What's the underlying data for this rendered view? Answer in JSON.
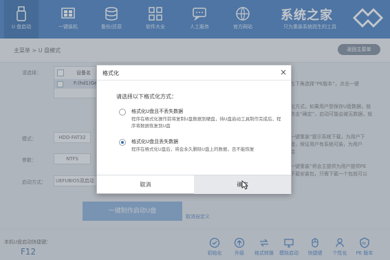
{
  "topnav": {
    "items": [
      {
        "label": "U 盘启动",
        "icon": "usb-drive-icon"
      },
      {
        "label": "一键装机",
        "icon": "windows-icon"
      },
      {
        "label": "备份/还原",
        "icon": "database-icon"
      },
      {
        "label": "软件大全",
        "icon": "apps-grid-icon"
      },
      {
        "label": "人工服务",
        "icon": "chat-icon"
      },
      {
        "label": "官方网站",
        "icon": "globe-icon"
      }
    ],
    "brand_title": "系统之家",
    "brand_slogan": "只为重装系统而生的工具"
  },
  "crumbbar": {
    "breadcrumb": "主菜单 > U 盘模式",
    "back_label": "返回主菜单"
  },
  "main": {
    "select_label": "请选择：",
    "device_header": "设备名",
    "device_row": "F:(hd1)Ge",
    "mode_label": "模式：",
    "mode_value": "HDD-FAT32",
    "param_label": "参数：",
    "param_value": "NTFS",
    "boot_label": "启动方式：",
    "boot_value": "UEFI/BIOS双启动",
    "hint1": "右下角选择“PE版本”，点击一键",
    "hint2a": "化方式，如果用户想保存U盘数据，就",
    "hint2b": "点击“确定”，启动可能会被无数据，就",
    "hint3a": "一键重装“提示系统下载，为用户下",
    "hint3b": "盘，保证用户有系统可装，为用户",
    "hint3c": "启",
    "hint4a": "一键重装”将会主提供为用户提供PE",
    "hint4b": "下载安装包，只需下载一个包就可以",
    "create_button": "一键制作启动U盘",
    "reset_link": "取消自定义"
  },
  "bottombar": {
    "hotkey_label": "本机U盘启动快捷键：",
    "hotkey_value": "F12",
    "tools": [
      {
        "label": "初始化",
        "icon": "check-circle-icon"
      },
      {
        "label": "升级",
        "icon": "upload-icon"
      },
      {
        "label": "格式转换",
        "icon": "convert-icon"
      },
      {
        "label": "模拟启动",
        "icon": "monitor-icon"
      },
      {
        "label": "快捷键",
        "icon": "mouse-icon"
      },
      {
        "label": "个性化",
        "icon": "person-icon"
      },
      {
        "label": "PE 版本",
        "icon": "pe-icon"
      }
    ]
  },
  "dialog": {
    "title": "格式化",
    "prompt": "请选择以下格式化方式：",
    "option1_title": "格式化U盘且不丢失数据",
    "option1_desc": "程序在格式化操作前将复制U盘数据到硬盘，待U盘启动工具制作完成后，程序将数据恢复到U盘",
    "option2_title": "格式化U盘且丢失数据",
    "option2_desc": "程序在格式化U盘后，将会永久删除U盘上的数据，且不能恢复",
    "selected_option": 2,
    "cancel_label": "取消",
    "ok_label": "确定"
  },
  "colors": {
    "primary": "#2d6cb7",
    "header_active": "#1d5a9e",
    "button_disabled": "#7ba4d1"
  }
}
